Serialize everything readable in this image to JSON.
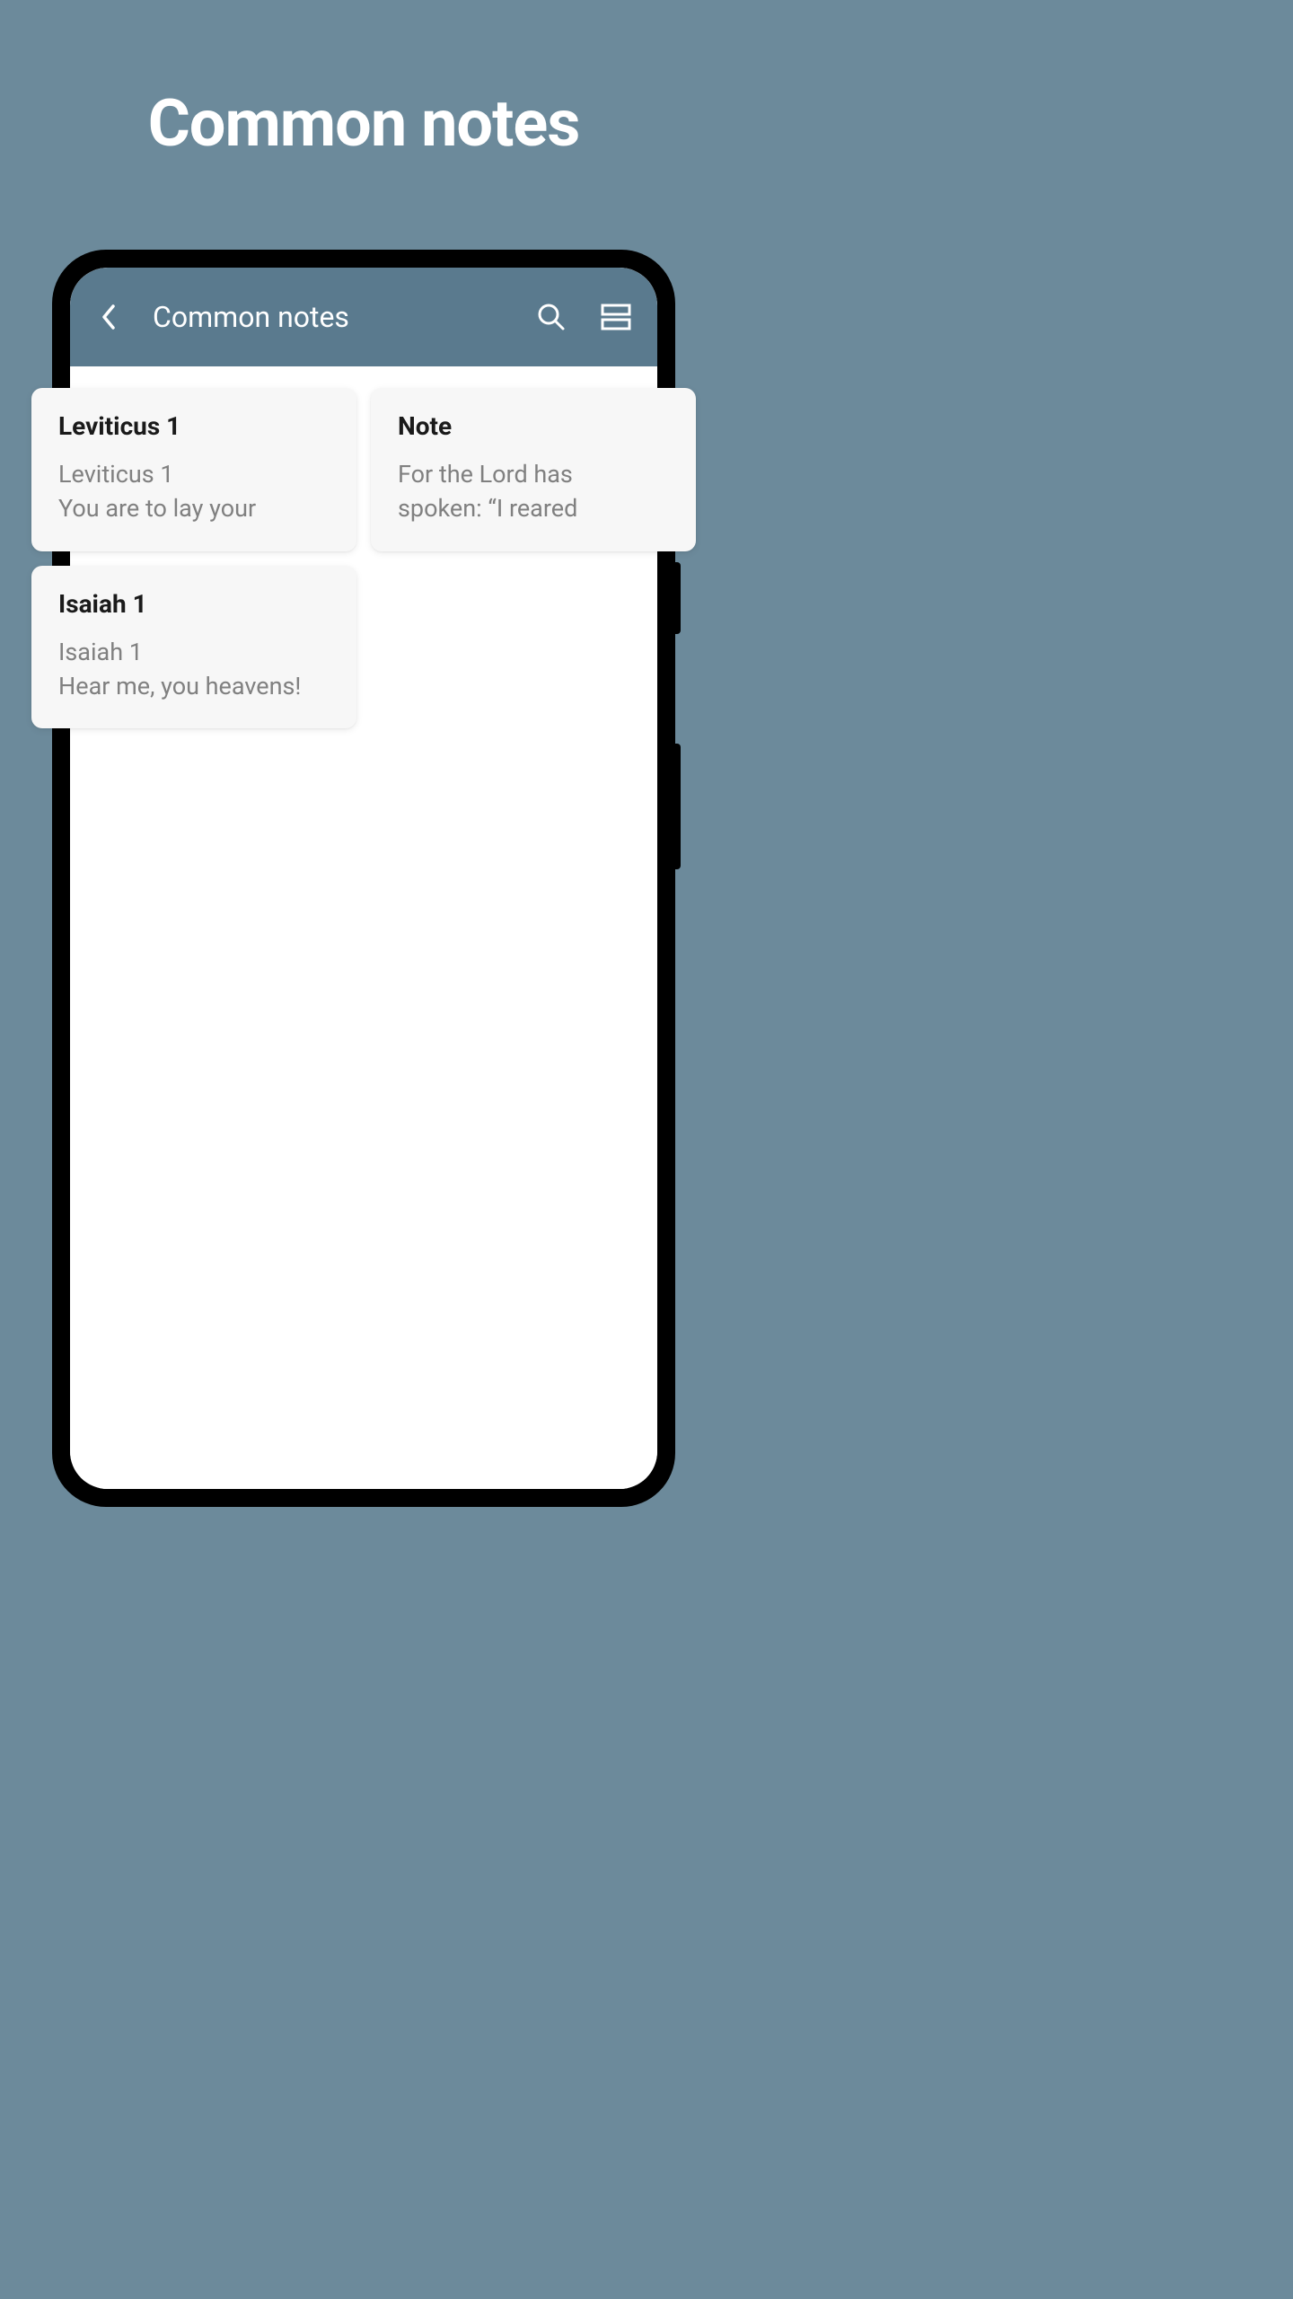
{
  "hero": {
    "title": "Common notes"
  },
  "header": {
    "title": "Common notes"
  },
  "notes": [
    {
      "title": "Leviticus 1",
      "line1": "Leviticus 1",
      "line2": "You are to lay your"
    },
    {
      "title": "Note",
      "line1": "For the Lord has",
      "line2": "spoken:  “I reared"
    },
    {
      "title": "Isaiah 1",
      "line1": "Isaiah 1",
      "line2": "Hear me, you heavens!"
    }
  ]
}
